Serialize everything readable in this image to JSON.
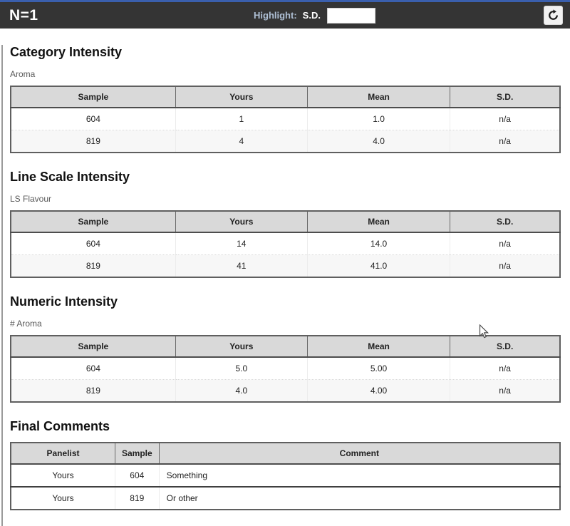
{
  "header": {
    "title": "N=1",
    "highlight_label": "Highlight:",
    "sd_label": "S.D.",
    "input_value": "",
    "refresh_icon": "refresh-icon"
  },
  "colors": {
    "accent_strip": "#3a5fad",
    "header_bar_bg": "#343434",
    "highlight_label_text": "#aebfd4",
    "table_header_bg": "#d9d9d9",
    "table_border": "#5f5f5f",
    "alt_row_bg": "#f7f7f7"
  },
  "sections": [
    {
      "title": "Category Intensity",
      "subtitle": "Aroma",
      "columns": [
        "Sample",
        "Yours",
        "Mean",
        "S.D."
      ],
      "rows": [
        [
          "604",
          "1",
          "1.0",
          "n/a"
        ],
        [
          "819",
          "4",
          "4.0",
          "n/a"
        ]
      ]
    },
    {
      "title": "Line Scale Intensity",
      "subtitle": "LS Flavour",
      "columns": [
        "Sample",
        "Yours",
        "Mean",
        "S.D."
      ],
      "rows": [
        [
          "604",
          "14",
          "14.0",
          "n/a"
        ],
        [
          "819",
          "41",
          "41.0",
          "n/a"
        ]
      ]
    },
    {
      "title": "Numeric Intensity",
      "subtitle": "# Aroma",
      "columns": [
        "Sample",
        "Yours",
        "Mean",
        "S.D."
      ],
      "rows": [
        [
          "604",
          "5.0",
          "5.00",
          "n/a"
        ],
        [
          "819",
          "4.0",
          "4.00",
          "n/a"
        ]
      ]
    }
  ],
  "comments": {
    "title": "Final Comments",
    "columns": [
      "Panelist",
      "Sample",
      "Comment"
    ],
    "rows": [
      [
        "Yours",
        "604",
        "Something"
      ],
      [
        "Yours",
        "819",
        "Or other"
      ]
    ]
  }
}
